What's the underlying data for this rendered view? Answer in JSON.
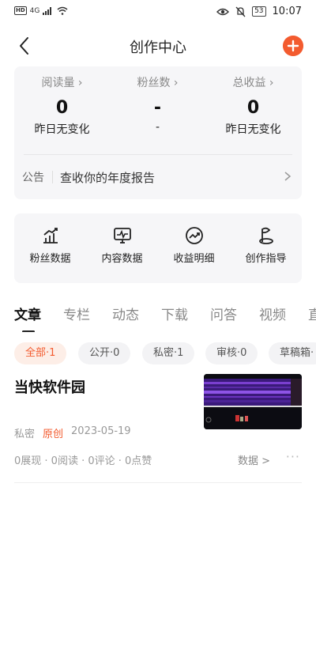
{
  "status_bar": {
    "network_badge": "HD",
    "network_type": "4G",
    "battery": "53",
    "time": "10:07"
  },
  "header": {
    "title": "创作中心"
  },
  "stats": [
    {
      "label": "阅读量",
      "value": "0",
      "sub": "昨日无变化"
    },
    {
      "label": "粉丝数",
      "value": "-",
      "sub": "-"
    },
    {
      "label": "总收益",
      "value": "0",
      "sub": "昨日无变化"
    }
  ],
  "notice": {
    "label": "公告",
    "text": "查收你的年度报告"
  },
  "tools": [
    {
      "label": "粉丝数据",
      "icon": "fan-data-chart-icon"
    },
    {
      "label": "内容数据",
      "icon": "content-monitor-icon"
    },
    {
      "label": "收益明细",
      "icon": "revenue-icon"
    },
    {
      "label": "创作指导",
      "icon": "creation-guide-flag-icon"
    }
  ],
  "tabs": [
    "文章",
    "专栏",
    "动态",
    "下载",
    "问答",
    "视频",
    "直"
  ],
  "active_tab": "文章",
  "chips": [
    "全部·1",
    "公开·0",
    "私密·1",
    "审核·0",
    "草稿箱·"
  ],
  "article": {
    "title": "当快软件园",
    "visibility": "私密",
    "type": "原创",
    "date": "2023-05-19",
    "stats": "0展现 · 0阅读 · 0评论 · 0点赞",
    "data_link": "数据 >",
    "more": "···"
  },
  "colors": {
    "accent": "#f35b2f",
    "card_bg": "#f6f6f8"
  }
}
